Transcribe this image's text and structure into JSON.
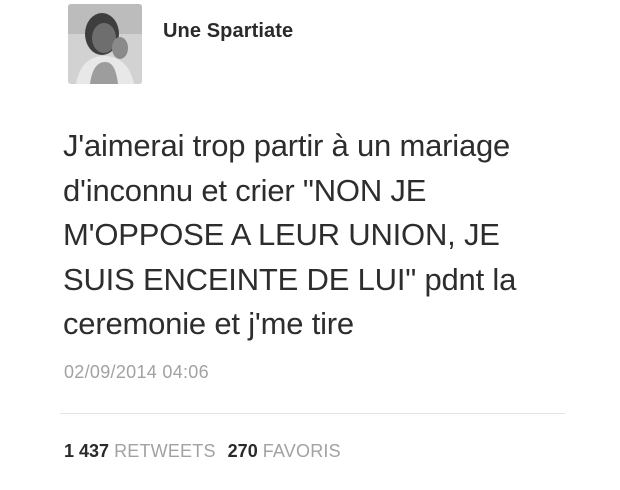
{
  "tweet": {
    "author": {
      "display_name": "Une Spartiate",
      "avatar": "profile-photo"
    },
    "text": "J'aimerai trop partir à un mariage\nd'inconnu et crier \"NON JE\nM'OPPOSE A LEUR UNION, JE\nSUIS ENCEINTE DE LUI\" pdnt la\nceremonie et j'me tire",
    "timestamp": "02/09/2014 04:06",
    "stats": {
      "retweets_count": "1 437",
      "retweets_label": "RETWEETS",
      "favorites_count": "270",
      "favorites_label": "FAVORIS"
    }
  },
  "colors": {
    "text": "#2d2d2d",
    "muted": "#a2a2a2",
    "divider": "#e4e4e4"
  }
}
